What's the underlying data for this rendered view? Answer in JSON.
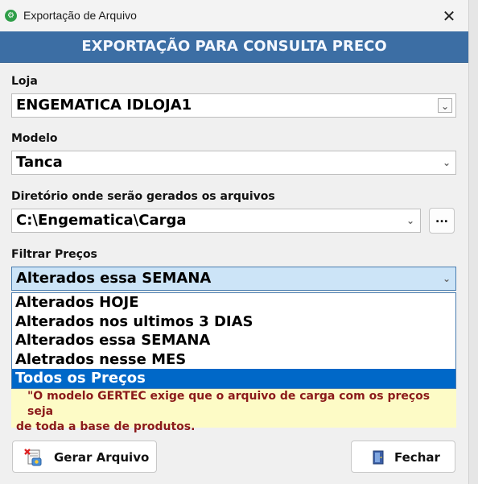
{
  "window": {
    "title": "Exportação de Arquivo",
    "close_glyph": "✕",
    "app_icon": "gear-icon"
  },
  "banner": {
    "title": "EXPORTAÇÃO PARA CONSULTA PRECO"
  },
  "loja": {
    "label": "Loja",
    "value": "ENGEMATICA IDLOJA1"
  },
  "modelo": {
    "label": "Modelo",
    "value": "Tanca"
  },
  "diretorio": {
    "label": "Diretório onde serão gerados os arquivos",
    "value": "C:\\Engematica\\Carga",
    "browse_label": "..."
  },
  "filtro": {
    "label": "Filtrar Preços",
    "value": "Alterados essa SEMANA",
    "options": [
      "Alterados HOJE",
      "Alterados nos ultimos 3 DIAS",
      "Alterados essa SEMANA",
      "Aletrados nesse MES",
      "Todos os Preços"
    ],
    "highlighted": "Todos os Preços"
  },
  "notice": {
    "line1": "\"O modelo GERTEC exige que o arquivo de carga com os preços seja",
    "line2": "de toda a base de produtos."
  },
  "buttons": {
    "gerar": "Gerar Arquivo",
    "fechar": "Fechar"
  },
  "colors": {
    "banner": "#3c6ea4",
    "selection": "#0068c8",
    "notice_bg": "#fdfbc6",
    "notice_text": "#8b1a1a"
  }
}
